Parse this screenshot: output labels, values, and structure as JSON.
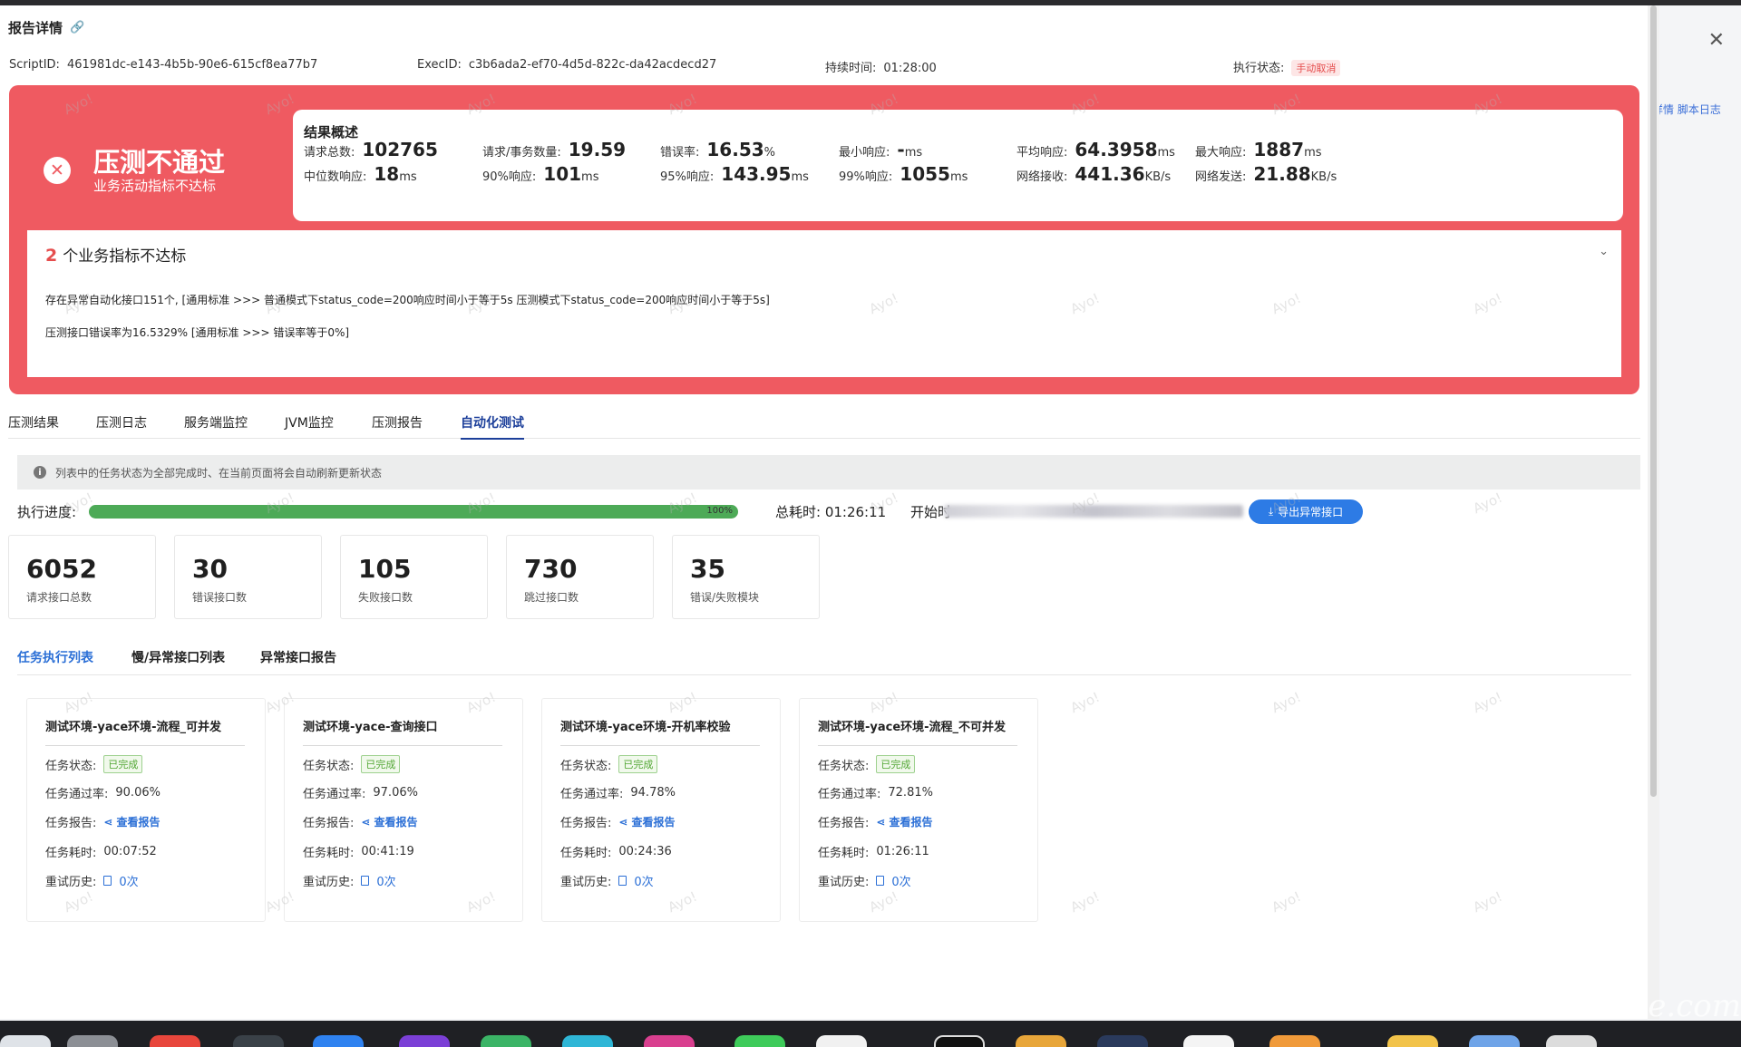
{
  "drawer": {
    "title": "报告详情",
    "link_icon": "link-icon",
    "close_icon": "close-icon"
  },
  "background": {
    "links": "详情  脚本日志"
  },
  "meta": {
    "script_id_label": "ScriptID:",
    "script_id": "461981dc-e143-4b5b-90e6-615cf8ea77b7",
    "exec_id_label": "ExecID:",
    "exec_id": "c3b6ada2-ef70-4d5d-822c-da42acdecd27",
    "duration_label": "持续时间:",
    "duration": "01:28:00",
    "status_label": "执行状态:",
    "status": "手动取消"
  },
  "result": {
    "title": "压测不通过",
    "subtitle": "业务活动指标不达标",
    "summary_title": "结果概述",
    "metrics": [
      {
        "label": "请求总数:",
        "value": "102765",
        "unit": ""
      },
      {
        "label": "请求/事务数量:",
        "value": "19.59",
        "unit": ""
      },
      {
        "label": "错误率:",
        "value": "16.53",
        "unit": "%"
      },
      {
        "label": "最小响应:",
        "value": "-",
        "unit": "ms"
      },
      {
        "label": "平均响应:",
        "value": "64.3958",
        "unit": "ms"
      },
      {
        "label": "最大响应:",
        "value": "1887",
        "unit": "ms"
      },
      {
        "label": "中位数响应:",
        "value": "18",
        "unit": "ms"
      },
      {
        "label": "90%响应:",
        "value": "101",
        "unit": "ms"
      },
      {
        "label": "95%响应:",
        "value": "143.95",
        "unit": "ms"
      },
      {
        "label": "99%响应:",
        "value": "1055",
        "unit": "ms"
      },
      {
        "label": "网络接收:",
        "value": "441.36",
        "unit": "KB/s"
      },
      {
        "label": "网络发送:",
        "value": "21.88",
        "unit": "KB/s"
      }
    ],
    "fail_count": "2",
    "fail_title": "个业务指标不达标",
    "fail_lines": [
      "存在异常自动化接口151个, [通用标准 >>> 普通模式下status_code=200响应时间小于等于5s 压测模式下status_code=200响应时间小于等于5s]",
      "压测接口错误率为16.5329% [通用标准 >>> 错误率等于0%]"
    ]
  },
  "tabs": [
    "压测结果",
    "压测日志",
    "服务端监控",
    "JVM监控",
    "压测报告",
    "自动化测试"
  ],
  "active_tab": "自动化测试",
  "info": "列表中的任务状态为全部完成时、在当前页面将会自动刷新更新状态",
  "progress": {
    "label": "执行进度:",
    "percent_text": "100%",
    "fraction": 1.0,
    "total_time": "总耗时: 01:26:11",
    "start_label": "开始时",
    "export_label": "导出异常接口",
    "bar_color": "#4daa57"
  },
  "stats": [
    {
      "value": "6052",
      "label": "请求接口总数"
    },
    {
      "value": "30",
      "label": "错误接口数"
    },
    {
      "value": "105",
      "label": "失败接口数"
    },
    {
      "value": "730",
      "label": "跳过接口数"
    },
    {
      "value": "35",
      "label": "错误/失败模块"
    }
  ],
  "subtabs": [
    "任务执行列表",
    "慢/异常接口列表",
    "异常接口报告"
  ],
  "tasks": [
    {
      "title": "测试环境-yace环境-流程_可并发",
      "status": "已完成",
      "pass_rate": "90.06%",
      "report": "查看报告",
      "duration": "00:07:52",
      "retry": "0次"
    },
    {
      "title": "测试环境-yace-查询接口",
      "status": "已完成",
      "pass_rate": "97.06%",
      "report": "查看报告",
      "duration": "00:41:19",
      "retry": "0次"
    },
    {
      "title": "测试环境-yace环境-开机率校验",
      "status": "已完成",
      "pass_rate": "94.78%",
      "report": "查看报告",
      "duration": "00:24:36",
      "retry": "0次"
    },
    {
      "title": "测试环境-yace环境-流程_不可并发",
      "status": "已完成",
      "pass_rate": "72.81%",
      "report": "查看报告",
      "duration": "01:26:11",
      "retry": "0次"
    }
  ],
  "task_labels": {
    "status": "任务状态:",
    "pass_rate": "任务通过率:",
    "report": "任务报告:",
    "duration": "任务耗时:",
    "retry": "重试历史:"
  },
  "watermark": "Ayo!",
  "dock_brand": "testerhome.com",
  "colors": {
    "fail_red": "#ef5a61",
    "accent_blue": "#2b6fd6",
    "success_green": "#52a735"
  }
}
